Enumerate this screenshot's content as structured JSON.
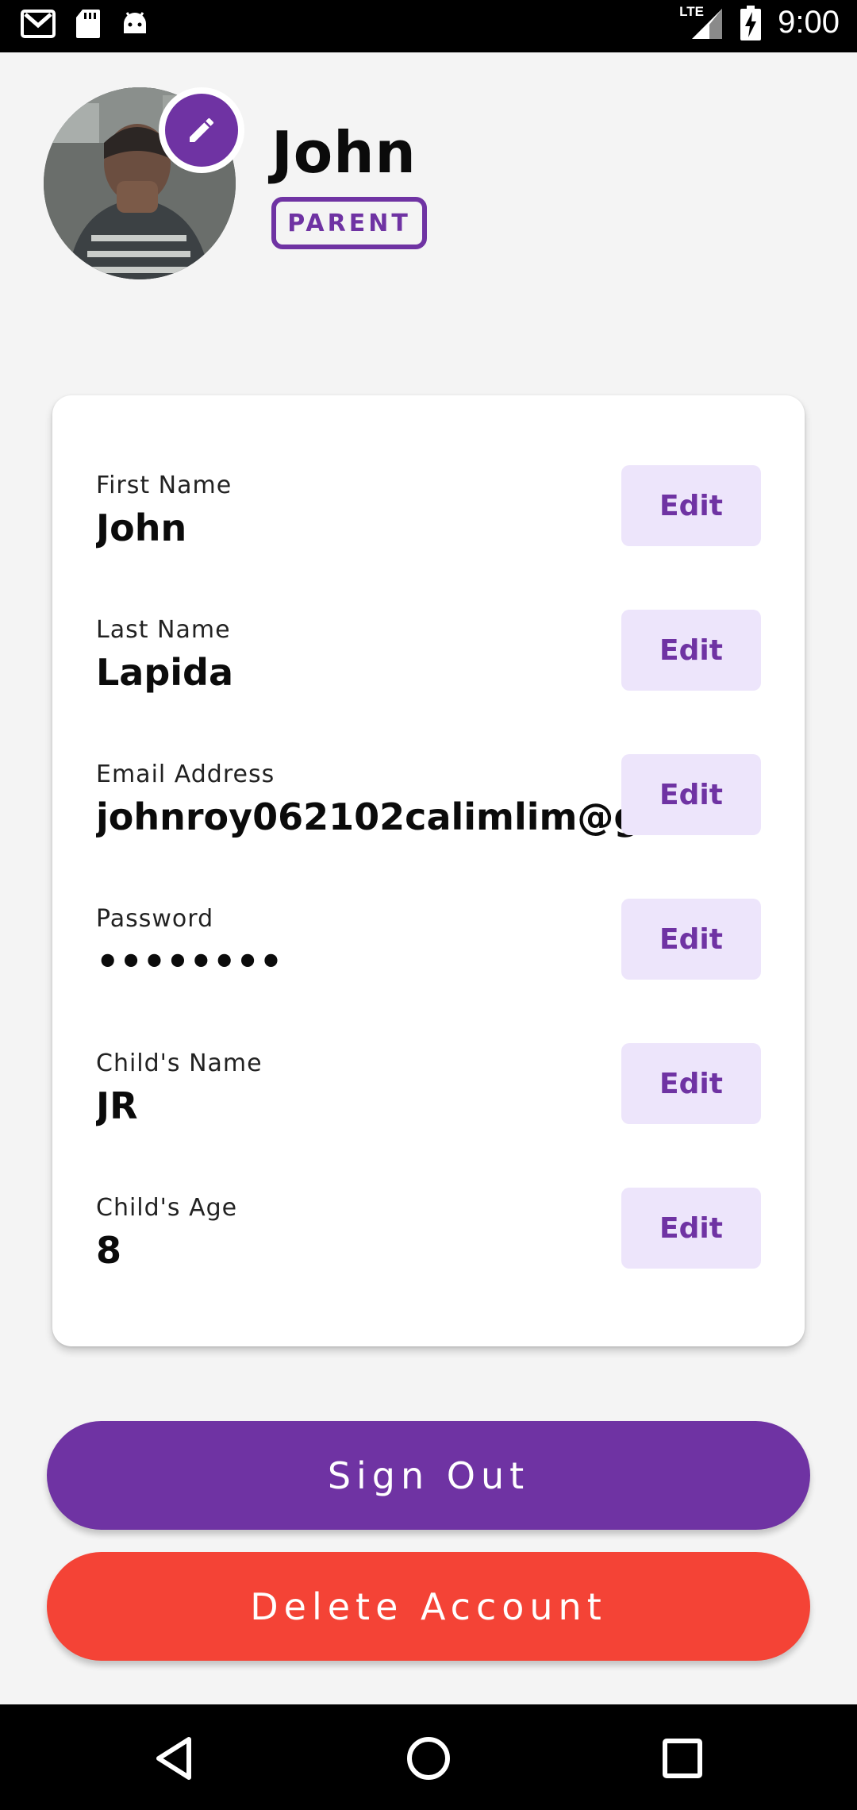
{
  "status_bar": {
    "time": "9:00",
    "network": "LTE",
    "left_icons": [
      "gmail-icon",
      "sd-card-icon",
      "android-icon"
    ],
    "right_icons": [
      "signal-icon",
      "battery-charging-icon"
    ]
  },
  "profile": {
    "name": "John",
    "role": "PARENT",
    "avatar_icon": "avatar-photo",
    "edit_icon": "pencil-icon"
  },
  "fields": [
    {
      "label": "First Name",
      "value": "John",
      "edit_label": "Edit"
    },
    {
      "label": "Last Name",
      "value": "Lapida",
      "edit_label": "Edit"
    },
    {
      "label": "Email Address",
      "value": "johnroy062102calimlim@g",
      "edit_label": "Edit"
    },
    {
      "label": "Password",
      "value": "••••••••",
      "edit_label": "Edit"
    },
    {
      "label": "Child's Name",
      "value": "JR",
      "edit_label": "Edit"
    },
    {
      "label": "Child's Age",
      "value": "8",
      "edit_label": "Edit"
    }
  ],
  "actions": {
    "sign_out": "Sign Out",
    "delete_account": "Delete Account"
  },
  "colors": {
    "accent": "#6f33a3",
    "danger": "#f44336",
    "edit_bg": "#ede5fb",
    "page_bg": "#f4f4f4"
  },
  "nav": {
    "icons": [
      "back-icon",
      "home-icon",
      "recents-icon"
    ]
  }
}
